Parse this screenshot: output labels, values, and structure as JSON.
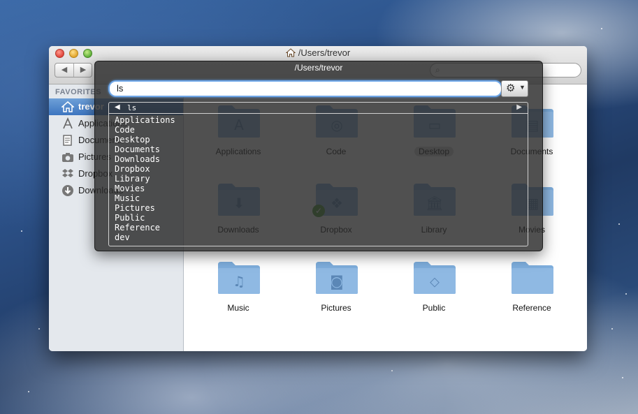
{
  "finder": {
    "title": "/Users/trevor",
    "title_icon": "home-icon",
    "back_glyph": "◀",
    "forward_glyph": "▶",
    "search_glyph": "⌕",
    "sidebar": {
      "heading": "FAVORITES",
      "items": [
        {
          "label": "trevor",
          "icon": "home-icon",
          "selected": true
        },
        {
          "label": "Applications",
          "icon": "applications-icon"
        },
        {
          "label": "Documents",
          "icon": "documents-icon"
        },
        {
          "label": "Pictures",
          "icon": "camera-icon"
        },
        {
          "label": "Dropbox",
          "icon": "dropbox-icon"
        },
        {
          "label": "Downloads",
          "icon": "downloads-icon"
        }
      ]
    },
    "items": [
      {
        "label": "Applications",
        "glyph": "A"
      },
      {
        "label": "Code",
        "glyph": "◎"
      },
      {
        "label": "Desktop",
        "glyph": "▭",
        "selected": true
      },
      {
        "label": "Documents",
        "glyph": "▤"
      },
      {
        "label": "Downloads",
        "glyph": "⬇"
      },
      {
        "label": "Dropbox",
        "glyph": "❖"
      },
      {
        "label": "Library",
        "glyph": "🏛"
      },
      {
        "label": "Movies",
        "glyph": "▦"
      },
      {
        "label": "Music",
        "glyph": "♫"
      },
      {
        "label": "Pictures",
        "glyph": "◙"
      },
      {
        "label": "Public",
        "glyph": "⬦"
      },
      {
        "label": "Reference",
        "glyph": ""
      }
    ]
  },
  "hud": {
    "title": "/Users/trevor",
    "input_value": "ls",
    "gear_glyph": "⚙",
    "caret_glyph": "▼",
    "list_header": "ls",
    "left_arrow": "◀",
    "right_arrow": "▶",
    "results": [
      "Applications",
      "Code",
      "Desktop",
      "Documents",
      "Downloads",
      "Dropbox",
      "Library",
      "Movies",
      "Music",
      "Pictures",
      "Public",
      "Reference",
      "dev"
    ]
  },
  "colors": {
    "folder_blue": "#8fb9e3",
    "sidebar_selection": "#3d75c0",
    "hud_background": "#2a2a2a",
    "focus_ring": "#6fa7e8"
  }
}
